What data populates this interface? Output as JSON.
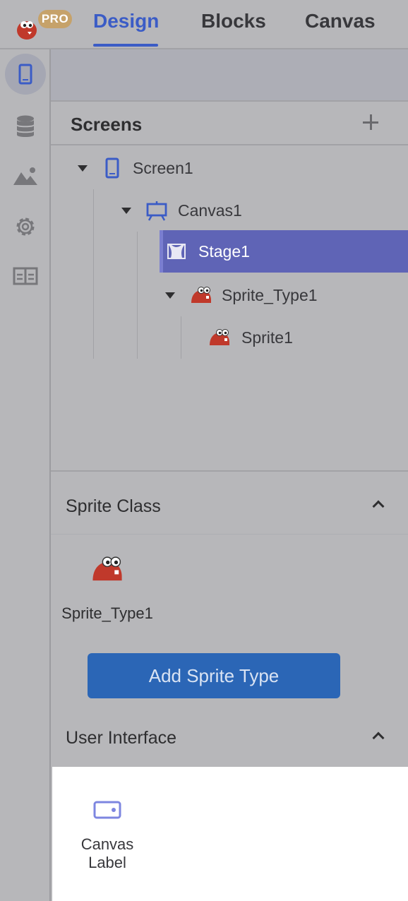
{
  "header": {
    "badge": "PRO",
    "tabs": [
      {
        "label": "Design",
        "active": true
      },
      {
        "label": "Blocks",
        "active": false
      },
      {
        "label": "Canvas",
        "active": false
      }
    ]
  },
  "rail": {
    "items": [
      {
        "icon": "phone-icon",
        "active": true
      },
      {
        "icon": "database-icon",
        "active": false
      },
      {
        "icon": "image-icon",
        "active": false
      },
      {
        "icon": "gear-icon",
        "active": false
      },
      {
        "icon": "layout-icon",
        "active": false
      }
    ]
  },
  "screens": {
    "title": "Screens",
    "tree": [
      {
        "label": "Screen1",
        "icon": "phone-icon",
        "expanded": true
      },
      {
        "label": "Canvas1",
        "icon": "canvas-easel-icon",
        "expanded": true
      },
      {
        "label": "Stage1",
        "icon": "stage-icon",
        "selected": true
      },
      {
        "label": "Sprite_Type1",
        "icon": "sprite-icon",
        "expanded": true
      },
      {
        "label": "Sprite1",
        "icon": "sprite-icon"
      }
    ]
  },
  "sprite_class": {
    "title": "Sprite Class",
    "item_label": "Sprite_Type1",
    "add_button": "Add Sprite Type"
  },
  "user_interface": {
    "title": "User Interface",
    "item_label_line1": "Canvas",
    "item_label_line2": "Label"
  },
  "colors": {
    "accent": "#3b5cc6",
    "selected_row": "#5f64b6",
    "button": "#2b66b6",
    "sprite": "#c0392b"
  }
}
